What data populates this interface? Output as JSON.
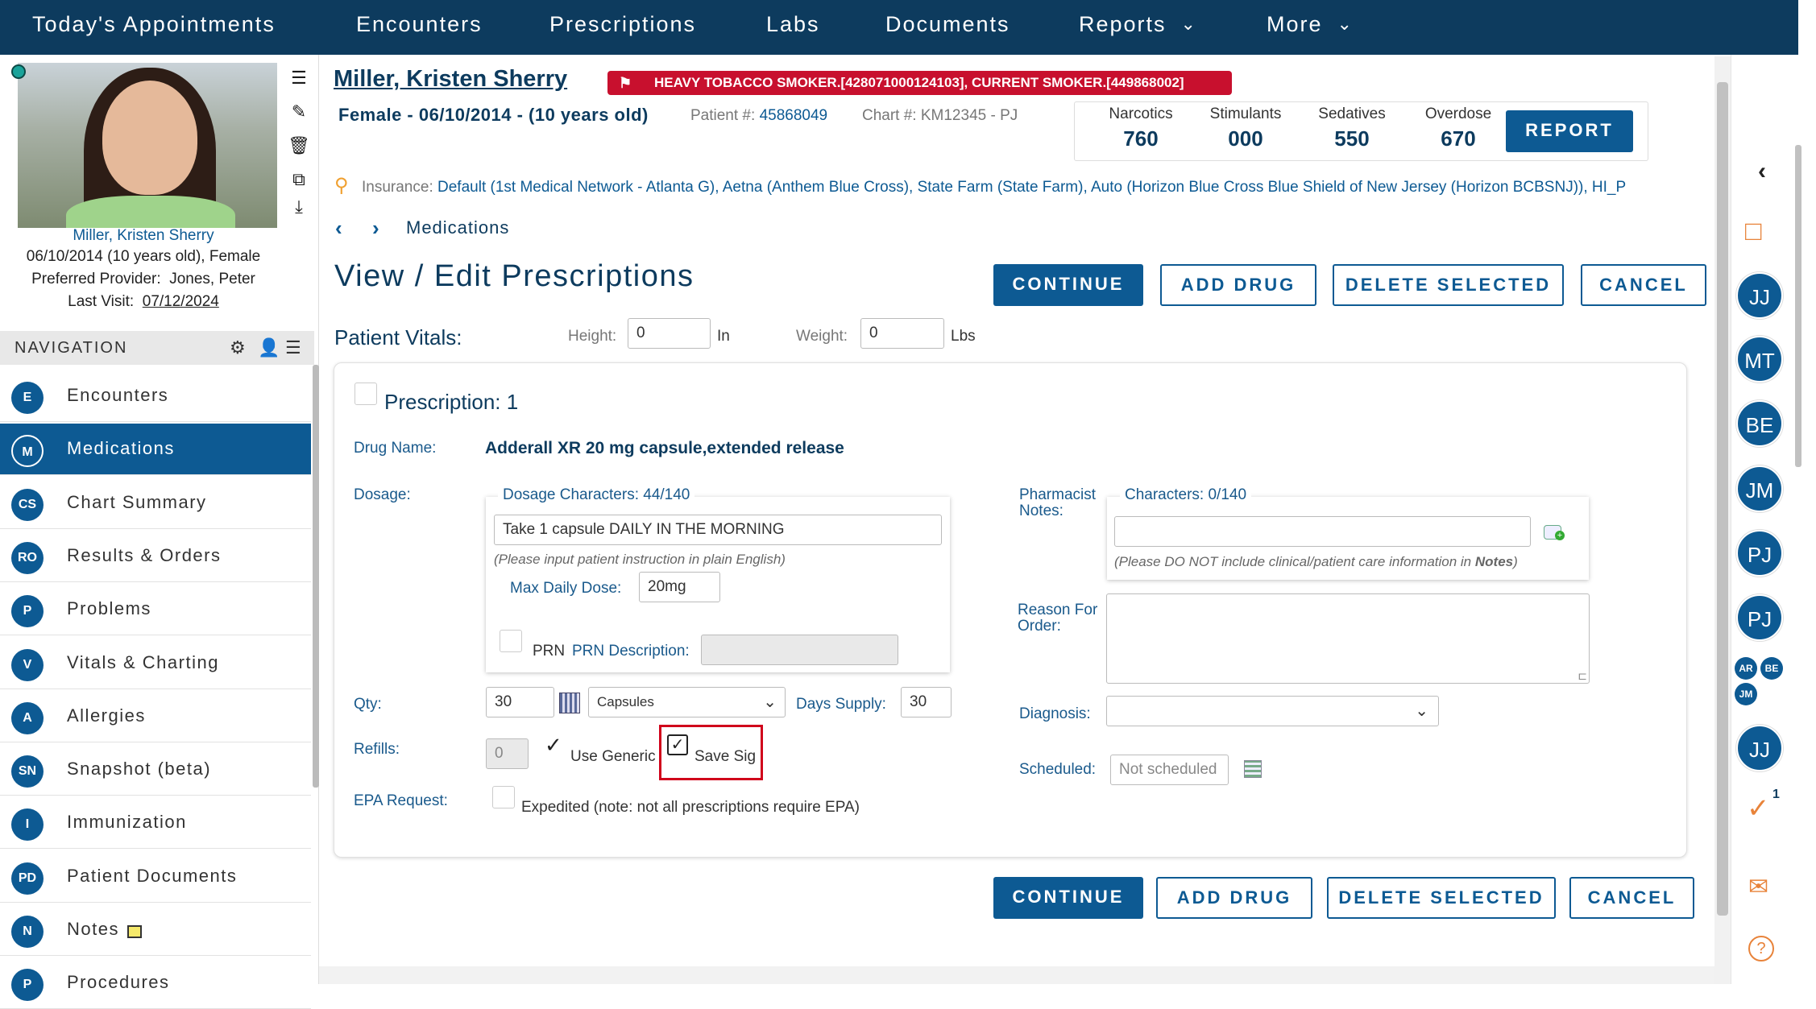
{
  "topnav": {
    "items": [
      "Today's Appointments",
      "Encounters",
      "Prescriptions",
      "Labs",
      "Documents",
      "Reports",
      "More"
    ]
  },
  "patient": {
    "name": "Miller, Kristen Sherry",
    "dob_age_sex": "06/10/2014 (10 years old), Female",
    "provider_label": "Preferred Provider:",
    "provider": "Jones, Peter",
    "last_visit_label": "Last Visit:",
    "last_visit": "07/12/2024",
    "header_line": "Female - 06/10/2014 - (10 years old)",
    "patient_num_label": "Patient #:",
    "patient_num": "45868049",
    "chart_num": "Chart #: KM12345 - PJ",
    "alert": "HEAVY TOBACCO SMOKER.[428071000124103], CURRENT SMOKER.[449868002]",
    "insurance_label": "Insurance:",
    "insurance": "Default (1st Medical Network - Atlanta G), Aetna (Anthem Blue Cross), State Farm (State Farm), Auto (Horizon Blue Cross Blue Shield of New Jersey (Horizon BCBSNJ)), HI_P"
  },
  "counters": [
    {
      "label": "Narcotics",
      "value": "760"
    },
    {
      "label": "Stimulants",
      "value": "000"
    },
    {
      "label": "Sedatives",
      "value": "550"
    },
    {
      "label": "Overdose",
      "value": "670"
    }
  ],
  "report_button": "REPORT",
  "navigation": {
    "title": "NAVIGATION",
    "items": [
      {
        "badge": "E",
        "label": "Encounters"
      },
      {
        "badge": "M",
        "label": "Medications"
      },
      {
        "badge": "CS",
        "label": "Chart Summary"
      },
      {
        "badge": "RO",
        "label": "Results & Orders"
      },
      {
        "badge": "P",
        "label": "Problems"
      },
      {
        "badge": "V",
        "label": "Vitals & Charting"
      },
      {
        "badge": "A",
        "label": "Allergies"
      },
      {
        "badge": "SN",
        "label": "Snapshot (beta)"
      },
      {
        "badge": "I",
        "label": "Immunization"
      },
      {
        "badge": "PD",
        "label": "Patient Documents"
      },
      {
        "badge": "N",
        "label": "Notes"
      },
      {
        "badge": "P",
        "label": "Procedures"
      }
    ]
  },
  "breadcrumb": "Medications",
  "page_title": "View / Edit Prescriptions",
  "buttons": {
    "continue": "CONTINUE",
    "add_drug": "ADD DRUG",
    "delete_selected": "DELETE SELECTED",
    "cancel": "CANCEL"
  },
  "vitals": {
    "title": "Patient Vitals:",
    "height_label": "Height:",
    "height_value": "0",
    "height_unit": "In",
    "weight_label": "Weight:",
    "weight_value": "0",
    "weight_unit": "Lbs"
  },
  "prescription": {
    "title": "Prescription: 1",
    "drug_name_label": "Drug Name:",
    "drug_name": "Adderall XR 20 mg capsule,extended release",
    "dosage_label": "Dosage:",
    "dosage_chars": "Dosage Characters: 44/140",
    "dosage_value": "Take 1 capsule DAILY IN THE MORNING",
    "dosage_hint": "(Please input patient instruction in plain English)",
    "max_daily_label": "Max Daily Dose:",
    "max_daily_value": "20mg",
    "prn_label": "PRN",
    "prn_desc_label": "PRN Description:",
    "qty_label": "Qty:",
    "qty_value": "30",
    "unit_value": "Capsules",
    "days_supply_label": "Days Supply:",
    "days_supply_value": "30",
    "refills_label": "Refills:",
    "refills_value": "0",
    "use_generic_label": "Use Generic",
    "save_sig_label": "Save Sig",
    "epa_label": "EPA Request:",
    "expedited_label": "Expedited (note: not all prescriptions require EPA)",
    "pharmacist_notes_label": "Pharmacist Notes:",
    "pharmacist_chars": "Characters: 0/140",
    "pharmacist_hint_pre": "(Please DO NOT include clinical/patient care information in ",
    "pharmacist_hint_bold": "Notes",
    "pharmacist_hint_post": ")",
    "reason_label": "Reason For Order:",
    "diagnosis_label": "Diagnosis:",
    "scheduled_label": "Scheduled:",
    "scheduled_placeholder": "Not scheduled"
  },
  "right_rail": {
    "avatars": [
      "JJ",
      "MT",
      "BE",
      "JM",
      "PJ",
      "PJ",
      "JJ"
    ],
    "mini_avatars": [
      "AR",
      "BE",
      "JM"
    ],
    "task_count": "1"
  },
  "colors": {
    "navy": "#0d3b5e",
    "primary": "#0d5a93",
    "alert_red": "#c8102e",
    "highlight_red": "#d0021b"
  }
}
